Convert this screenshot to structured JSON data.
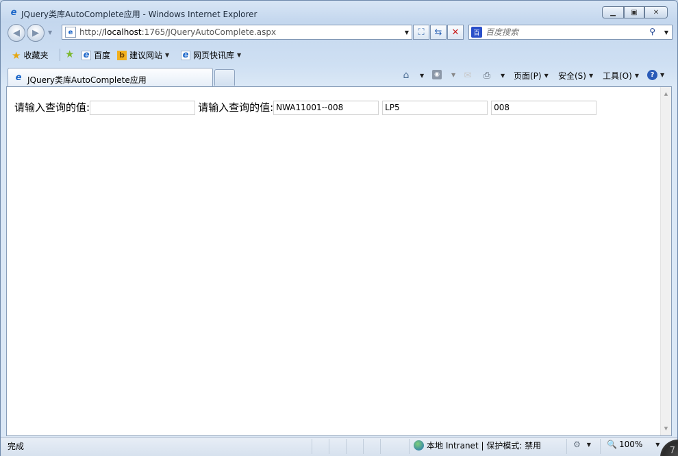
{
  "window": {
    "title": "JQuery类库AutoComplete应用 - Windows Internet Explorer",
    "minimize_icon": "minimize-icon",
    "restore_icon": "restore-icon",
    "close_icon": "close-icon"
  },
  "address_bar": {
    "url_prefix": "http://",
    "url_host": "localhost",
    "url_rest": ":1765/JQueryAutoComplete.aspx"
  },
  "search": {
    "placeholder": "百度搜索"
  },
  "favorites": {
    "favorites_label": "收藏夹",
    "items": [
      {
        "label": "百度",
        "icon": "ie-page-icon"
      },
      {
        "label": "建议网站",
        "icon": "bing-icon"
      },
      {
        "label": "网页快讯库",
        "icon": "ie-page-icon"
      }
    ]
  },
  "tabs": [
    {
      "label": "JQuery类库AutoComplete应用",
      "active": true
    }
  ],
  "command_bar": {
    "page_label": "页面(P)",
    "safety_label": "安全(S)",
    "tools_label": "工具(O)"
  },
  "page": {
    "label1": "请输入查询的值:",
    "input1_value": "",
    "label2": "请输入查询的值:",
    "input2_value": "NWA11001--008",
    "input3_value": "LP5",
    "input4_value": "008"
  },
  "status_bar": {
    "status": "完成",
    "zone": "本地 Intranet | 保护模式: 禁用",
    "zoom": "100%",
    "corner_char": "7"
  }
}
